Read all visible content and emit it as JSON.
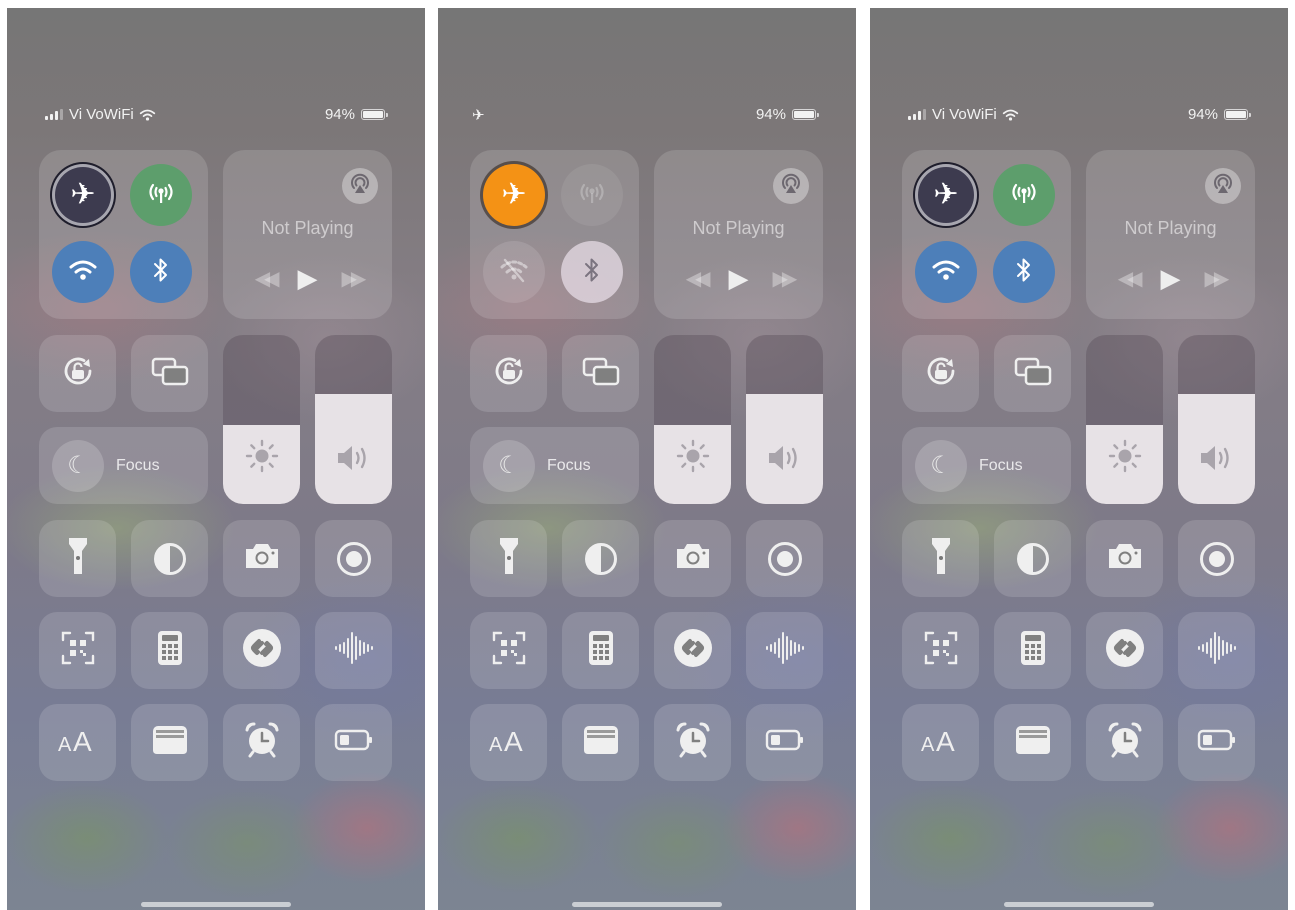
{
  "phones": [
    {
      "status": {
        "carrier": "Vi VoWiFi",
        "battery": "94%",
        "airplane_indicator": "",
        "signal_visible": true,
        "wifi_visible": true
      },
      "connectivity": {
        "airplane_mode": false,
        "cellular": true,
        "wifi": true,
        "bluetooth": true
      },
      "media": {
        "status": "Not Playing"
      },
      "focus": {
        "label": "Focus"
      },
      "brightness": 0.47,
      "volume": 0.65
    },
    {
      "status": {
        "carrier": "",
        "battery": "94%",
        "airplane_indicator": "✈",
        "signal_visible": false,
        "wifi_visible": false
      },
      "connectivity": {
        "airplane_mode": true,
        "cellular": false,
        "wifi": false,
        "bluetooth": false
      },
      "media": {
        "status": "Not Playing"
      },
      "focus": {
        "label": "Focus"
      },
      "brightness": 0.47,
      "volume": 0.65
    },
    {
      "status": {
        "carrier": "Vi VoWiFi",
        "battery": "94%",
        "airplane_indicator": "",
        "signal_visible": true,
        "wifi_visible": true
      },
      "connectivity": {
        "airplane_mode": false,
        "cellular": true,
        "wifi": true,
        "bluetooth": true
      },
      "media": {
        "status": "Not Playing"
      },
      "focus": {
        "label": "Focus"
      },
      "brightness": 0.47,
      "volume": 0.65
    }
  ],
  "icons": {
    "airplane": "airplane-icon",
    "cellular": "cellular-data-icon",
    "wifi": "wifi-icon",
    "bluetooth": "bluetooth-icon",
    "airplay": "airplay-icon",
    "rotation_lock": "rotation-lock-icon",
    "screen_mirroring": "screen-mirroring-icon",
    "focus": "moon-icon",
    "brightness": "sun-icon",
    "volume": "speaker-icon",
    "grid": [
      "flashlight-icon",
      "dark-mode-icon",
      "camera-icon",
      "screen-record-icon",
      "qr-scanner-icon",
      "calculator-icon",
      "shazam-icon",
      "voice-memos-icon",
      "text-size-icon",
      "wallet-icon",
      "alarm-icon",
      "low-power-mode-icon"
    ]
  },
  "colors": {
    "airplane_active": "#f49215",
    "airplane_inactive": "#3d3b4f",
    "cellular_active": "#5d9e6c",
    "wifi_bluetooth_active": "#4d7fb9"
  }
}
